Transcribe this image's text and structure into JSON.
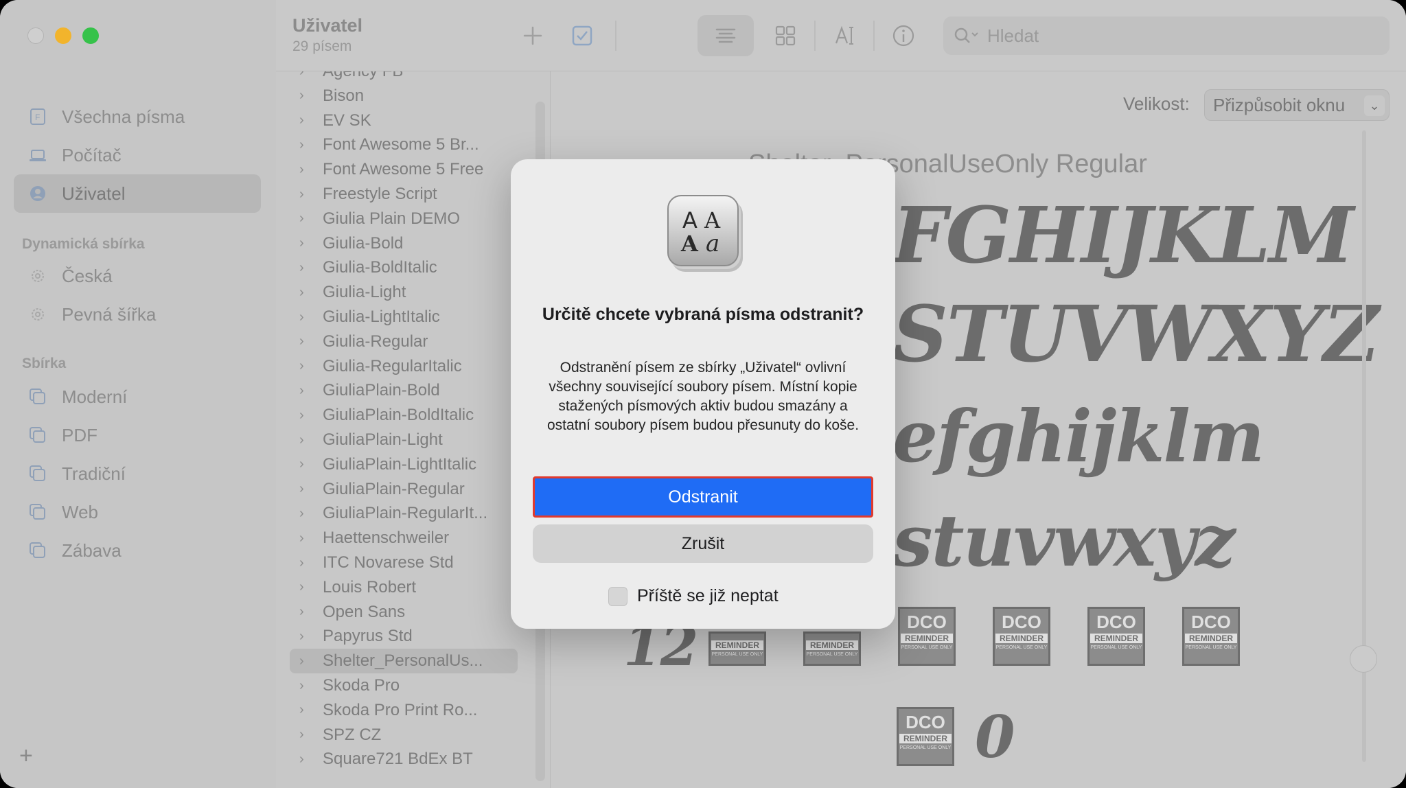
{
  "sidebar": {
    "items": [
      {
        "label": "Všechna písma",
        "icon": "font-file-icon"
      },
      {
        "label": "Počítač",
        "icon": "laptop-icon"
      },
      {
        "label": "Uživatel",
        "icon": "user-icon"
      }
    ],
    "dynamic_heading": "Dynamická sbírka",
    "dynamic_items": [
      {
        "label": "Česká",
        "icon": "gear-icon"
      },
      {
        "label": "Pevná šířka",
        "icon": "gear-icon"
      }
    ],
    "collection_heading": "Sbírka",
    "collection_items": [
      {
        "label": "Moderní",
        "icon": "collection-icon"
      },
      {
        "label": "PDF",
        "icon": "collection-icon"
      },
      {
        "label": "Tradiční",
        "icon": "collection-icon"
      },
      {
        "label": "Web",
        "icon": "collection-icon"
      },
      {
        "label": "Zábava",
        "icon": "collection-icon"
      }
    ],
    "add_label": "+"
  },
  "toolbar": {
    "title": "Uživatel",
    "subtitle": "29 písem",
    "search_placeholder": "Hledat"
  },
  "fonts": [
    "Agency FB",
    "Bison",
    "EV SK",
    "Font Awesome 5 Br...",
    "Font Awesome 5 Free",
    "Freestyle Script",
    "Giulia Plain DEMO",
    "Giulia-Bold",
    "Giulia-BoldItalic",
    "Giulia-Light",
    "Giulia-LightItalic",
    "Giulia-Regular",
    "Giulia-RegularItalic",
    "GiuliaPlain-Bold",
    "GiuliaPlain-BoldItalic",
    "GiuliaPlain-Light",
    "GiuliaPlain-LightItalic",
    "GiuliaPlain-Regular",
    "GiuliaPlain-RegularIt...",
    "Haettenschweiler",
    "ITC Novarese Std",
    "Louis Robert",
    "Open Sans",
    "Papyrus Std",
    "Shelter_PersonalUs...",
    "Skoda Pro",
    "Skoda Pro Print Ro...",
    "SPZ CZ",
    "Square721 BdEx BT"
  ],
  "selected_font_index": 24,
  "preview": {
    "size_label": "Velikost:",
    "size_value": "Přizpůsobit oknu",
    "title": "Shelter_PersonalUseOnly Regular",
    "lines": [
      "FGHIJKLM",
      "STUVWXYZ",
      "efghijklm",
      "stuvwxyz"
    ],
    "digits_left": "12",
    "digit_right": "0",
    "dco_top": "DCO",
    "dco_mid": "REMINDER",
    "dco_small": "PERSONAL USE ONLY"
  },
  "dialog": {
    "title": "Určitě chcete vybraná písma odstranit?",
    "message": "Odstranění písem ze sbírky „Uživatel“ ovlivní všechny související soubory písem. Místní kopie stažených písmových aktiv budou smazány a ostatní soubory písem budou přesunuty do koše.",
    "primary": "Odstranit",
    "secondary": "Zrušit",
    "checkbox_label": "Příště se již neptat"
  }
}
